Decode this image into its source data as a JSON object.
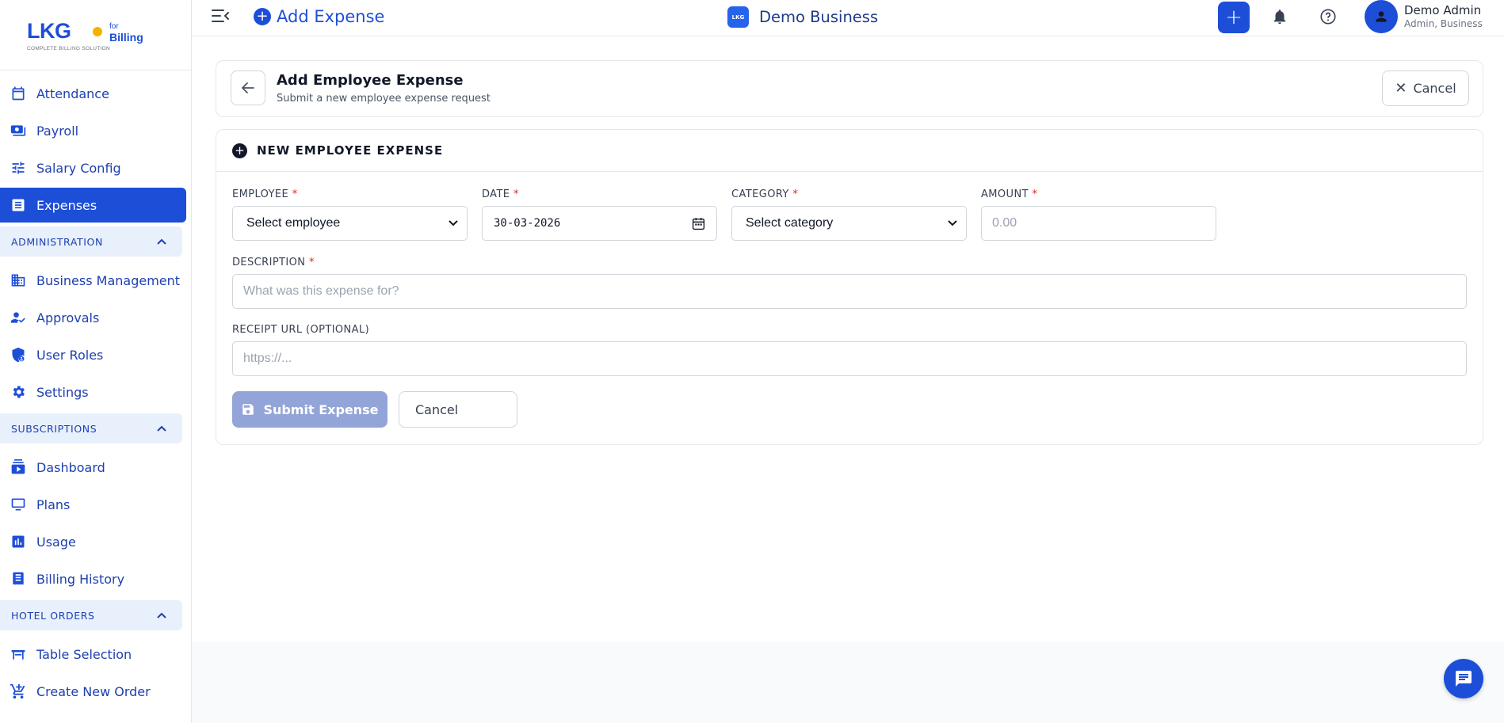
{
  "brand": {
    "name": "LKG",
    "for": "for",
    "product": "Billing",
    "tagline": "COMPLETE BILLING SOLUTION"
  },
  "sidebar": {
    "items": [
      {
        "label": "Attendance",
        "icon": "calendar-icon"
      },
      {
        "label": "Payroll",
        "icon": "cash-icon"
      },
      {
        "label": "Salary Config",
        "icon": "sliders-icon"
      },
      {
        "label": "Expenses",
        "icon": "receipt-icon",
        "active": true
      }
    ],
    "administration": {
      "title": "ADMINISTRATION",
      "items": [
        {
          "label": "Business Management",
          "icon": "building-icon"
        },
        {
          "label": "Approvals",
          "icon": "user-check-icon"
        },
        {
          "label": "User Roles",
          "icon": "shield-user-icon"
        },
        {
          "label": "Settings",
          "icon": "gear-icon"
        }
      ]
    },
    "subscriptions": {
      "title": "SUBSCRIPTIONS",
      "items": [
        {
          "label": "Dashboard",
          "icon": "dashboard-icon"
        },
        {
          "label": "Plans",
          "icon": "plans-icon"
        },
        {
          "label": "Usage",
          "icon": "bar-chart-icon"
        },
        {
          "label": "Billing History",
          "icon": "history-icon"
        }
      ]
    },
    "hotel_orders": {
      "title": "HOTEL ORDERS",
      "items": [
        {
          "label": "Table Selection",
          "icon": "table-icon"
        },
        {
          "label": "Create New Order",
          "icon": "cart-icon"
        }
      ]
    }
  },
  "header": {
    "page_title": "Add Expense",
    "business_name": "Demo Business",
    "business_badge": "LKG",
    "user_name": "Demo Admin",
    "user_role": "Admin, Business"
  },
  "page": {
    "title": "Add Employee Expense",
    "subtitle": "Submit a new employee expense request",
    "cancel_label": "Cancel"
  },
  "form": {
    "section_title": "NEW EMPLOYEE EXPENSE",
    "employee": {
      "label": "EMPLOYEE",
      "value": "Select employee"
    },
    "date": {
      "label": "DATE",
      "value": "30-03-2026"
    },
    "category": {
      "label": "CATEGORY",
      "value": "Select category"
    },
    "amount": {
      "label": "AMOUNT",
      "placeholder": "0.00"
    },
    "description": {
      "label": "DESCRIPTION",
      "placeholder": "What was this expense for?"
    },
    "receipt": {
      "label": "RECEIPT URL (OPTIONAL)",
      "placeholder": "https://..."
    },
    "required_mark": "*",
    "submit_label": "Submit Expense",
    "cancel_label": "Cancel"
  },
  "colors": {
    "primary": "#1d4ed8",
    "section_bg": "#e8f0fb",
    "submit_disabled": "#93a5d8",
    "required": "#dc2626"
  }
}
